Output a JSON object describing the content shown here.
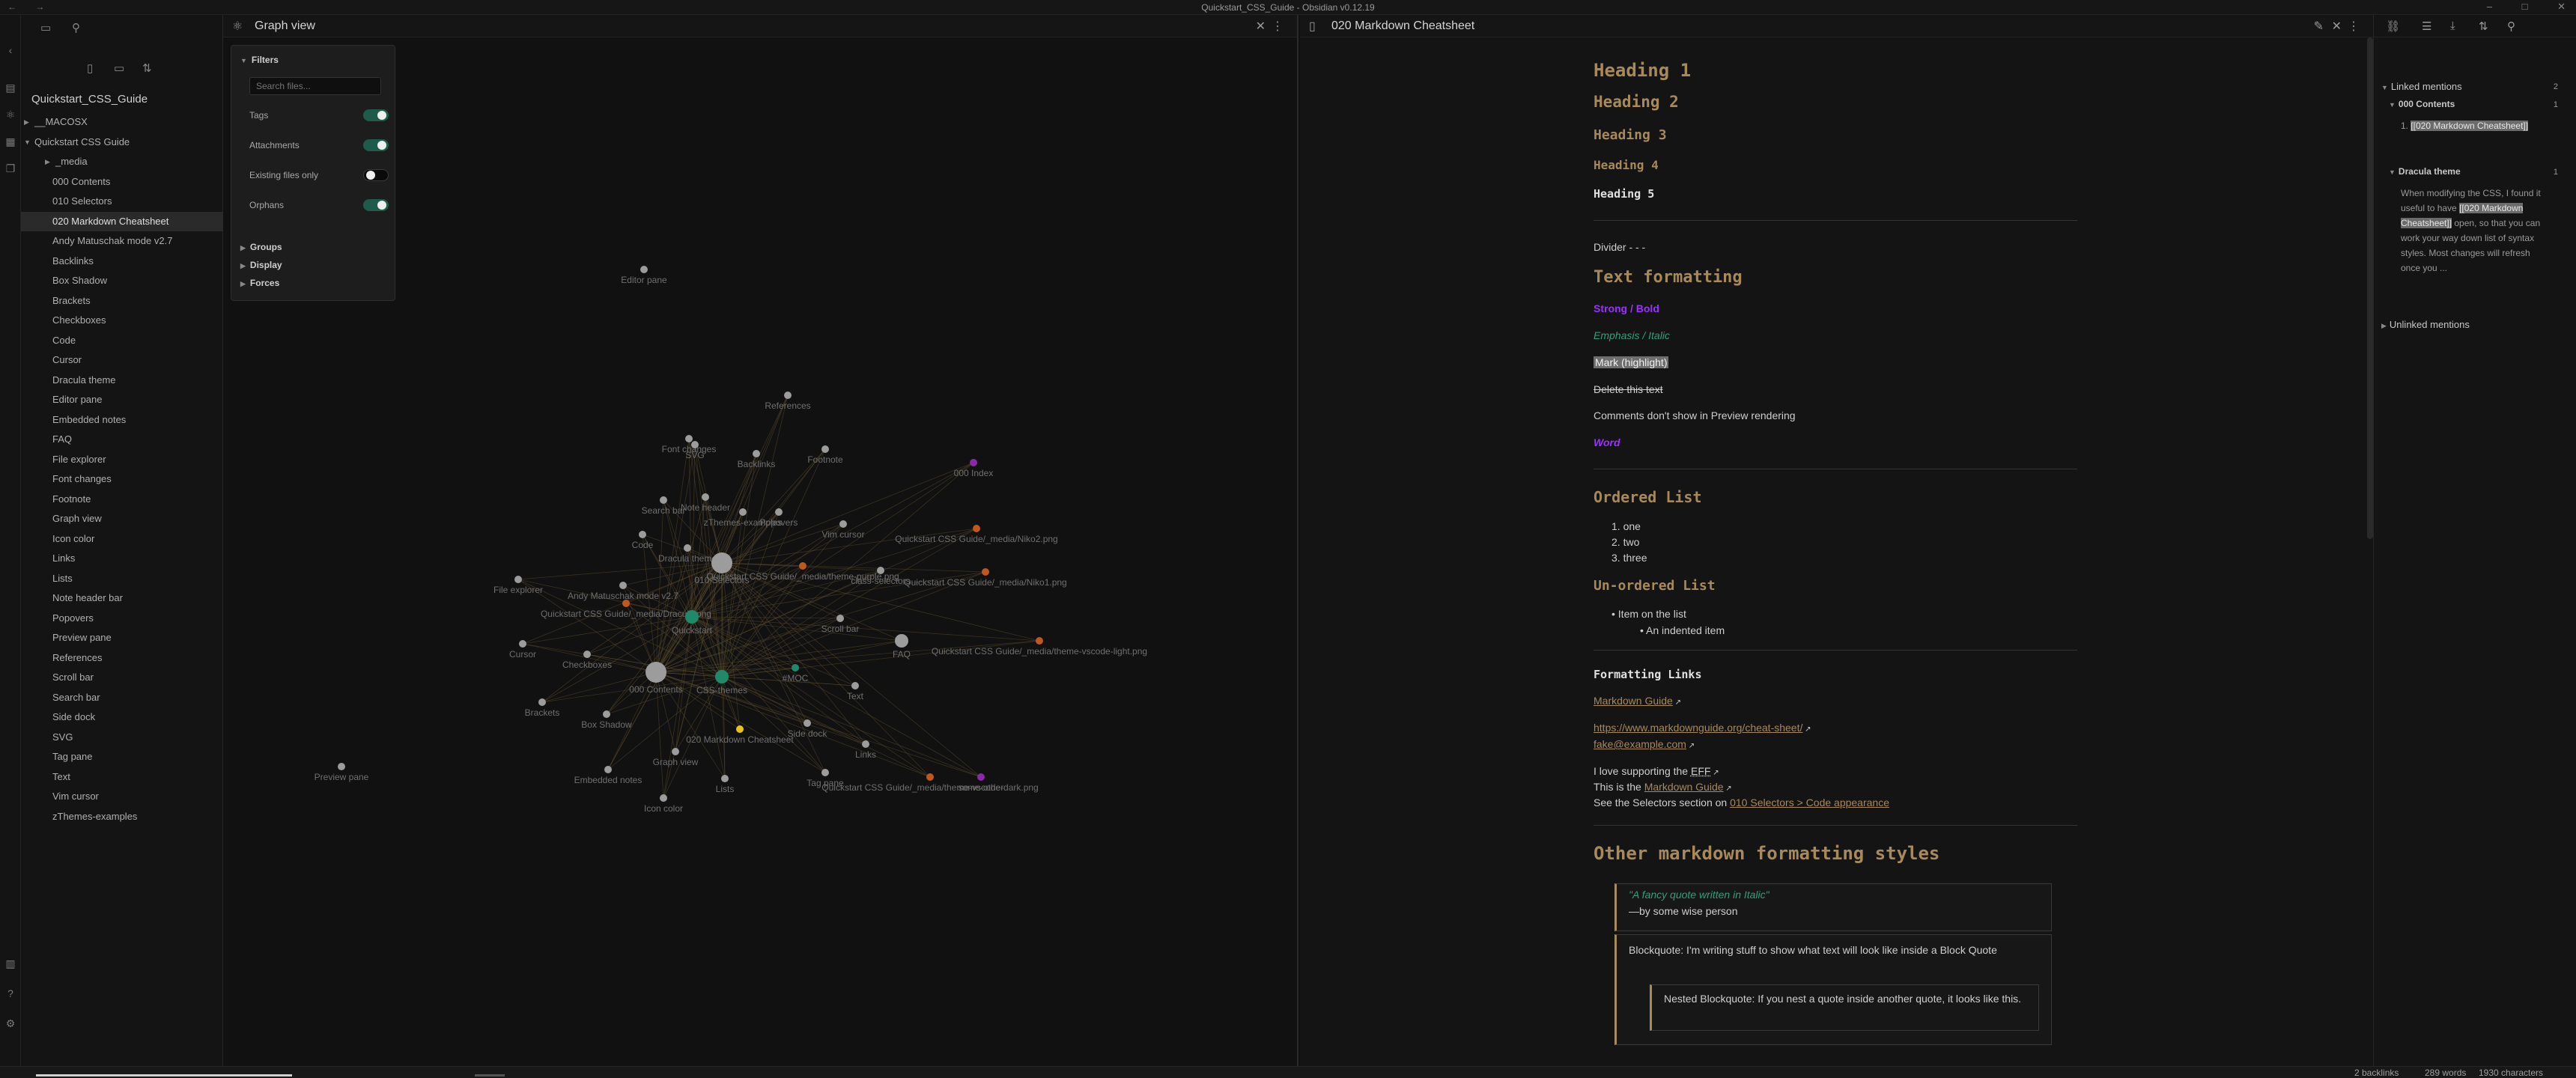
{
  "window": {
    "title": "Quickstart_CSS_Guide - Obsidian v0.12.19",
    "nav_back": "←",
    "nav_forward": "→",
    "minimize": "–",
    "maximize": "□",
    "close": "✕"
  },
  "ribbon": {
    "icons": [
      "collapse-icon",
      "quick-switcher-icon",
      "graph-icon",
      "calendar-icon",
      "copy-icon",
      "vault-icon",
      "help-icon",
      "settings-icon"
    ]
  },
  "left_sidebar": {
    "vault_name": "Quickstart_CSS_Guide",
    "tree": [
      {
        "label": "__MACOSX",
        "level": 0,
        "folder": true,
        "expanded": false
      },
      {
        "label": "Quickstart CSS Guide",
        "level": 0,
        "folder": true,
        "expanded": true
      },
      {
        "label": "_media",
        "level": 1,
        "folder": true,
        "expanded": false
      },
      {
        "label": "000 Contents",
        "level": 1
      },
      {
        "label": "010 Selectors",
        "level": 1
      },
      {
        "label": "020 Markdown Cheatsheet",
        "level": 1,
        "active": true
      },
      {
        "label": "Andy Matuschak mode v2.7",
        "level": 1
      },
      {
        "label": "Backlinks",
        "level": 1
      },
      {
        "label": "Box Shadow",
        "level": 1
      },
      {
        "label": "Brackets",
        "level": 1
      },
      {
        "label": "Checkboxes",
        "level": 1
      },
      {
        "label": "Code",
        "level": 1
      },
      {
        "label": "Cursor",
        "level": 1
      },
      {
        "label": "Dracula theme",
        "level": 1
      },
      {
        "label": "Editor pane",
        "level": 1
      },
      {
        "label": "Embedded notes",
        "level": 1
      },
      {
        "label": "FAQ",
        "level": 1
      },
      {
        "label": "File explorer",
        "level": 1
      },
      {
        "label": "Font changes",
        "level": 1
      },
      {
        "label": "Footnote",
        "level": 1
      },
      {
        "label": "Graph view",
        "level": 1
      },
      {
        "label": "Icon color",
        "level": 1
      },
      {
        "label": "Links",
        "level": 1
      },
      {
        "label": "Lists",
        "level": 1
      },
      {
        "label": "Note header bar",
        "level": 1
      },
      {
        "label": "Popovers",
        "level": 1
      },
      {
        "label": "Preview pane",
        "level": 1
      },
      {
        "label": "References",
        "level": 1
      },
      {
        "label": "Scroll bar",
        "level": 1
      },
      {
        "label": "Search bar",
        "level": 1
      },
      {
        "label": "Side dock",
        "level": 1
      },
      {
        "label": "SVG",
        "level": 1
      },
      {
        "label": "Tag pane",
        "level": 1
      },
      {
        "label": "Text",
        "level": 1
      },
      {
        "label": "Vim cursor",
        "level": 1
      },
      {
        "label": "zThemes-examples",
        "level": 1
      }
    ]
  },
  "graph": {
    "title": "Graph view",
    "filters": {
      "header": "Filters",
      "search_placeholder": "Search files...",
      "toggles": [
        {
          "label": "Tags",
          "on": true
        },
        {
          "label": "Attachments",
          "on": true
        },
        {
          "label": "Existing files only",
          "on": false
        },
        {
          "label": "Orphans",
          "on": true
        }
      ],
      "sections": [
        "Groups",
        "Display",
        "Forces"
      ]
    },
    "nodes": [
      {
        "label": "Editor pane",
        "color": "grey",
        "size": "s"
      },
      {
        "label": "References",
        "color": "grey",
        "size": "s"
      },
      {
        "label": "Font changes",
        "color": "grey",
        "size": "s"
      },
      {
        "label": "SVG",
        "color": "grey",
        "size": "s"
      },
      {
        "label": "Backlinks",
        "color": "grey",
        "size": "s"
      },
      {
        "label": "Footnote",
        "color": "grey",
        "size": "s"
      },
      {
        "label": "000 Index",
        "color": "purple",
        "size": "s"
      },
      {
        "label": "Search bar",
        "color": "grey",
        "size": "s"
      },
      {
        "label": "Note header",
        "color": "grey",
        "size": "s"
      },
      {
        "label": "zThemes-examples",
        "color": "grey",
        "size": "s"
      },
      {
        "label": "Popovers",
        "color": "grey",
        "size": "s"
      },
      {
        "label": "Vim cursor",
        "color": "grey",
        "size": "s"
      },
      {
        "label": "Quickstart CSS Guide/_media/Niko2.png",
        "color": "orange",
        "size": "s"
      },
      {
        "label": "Code",
        "color": "grey",
        "size": "s"
      },
      {
        "label": "Dracula theme",
        "color": "grey",
        "size": "s"
      },
      {
        "label": "010 Selectors",
        "color": "grey",
        "size": "l"
      },
      {
        "label": "Quickstart CSS Guide/_media/theme-purple.png",
        "color": "orange",
        "size": "s"
      },
      {
        "label": "class-selectors",
        "color": "grey",
        "size": "s"
      },
      {
        "label": "Quickstart CSS Guide/_media/Niko1.png",
        "color": "orange",
        "size": "s"
      },
      {
        "label": "File explorer",
        "color": "grey",
        "size": "s"
      },
      {
        "label": "Andy Matuschak mode v2.7",
        "color": "grey",
        "size": "s"
      },
      {
        "label": "Quickstart CSS Guide/_media/Dracula.png",
        "color": "orange",
        "size": "s"
      },
      {
        "label": "Quickstart",
        "color": "green",
        "size": "m"
      },
      {
        "label": "Scroll bar",
        "color": "grey",
        "size": "s"
      },
      {
        "label": "FAQ",
        "color": "grey",
        "size": "m"
      },
      {
        "label": "Quickstart CSS Guide/_media/theme-vscode-light.png",
        "color": "orange",
        "size": "s"
      },
      {
        "label": "Cursor",
        "color": "grey",
        "size": "s"
      },
      {
        "label": "Checkboxes",
        "color": "grey",
        "size": "s"
      },
      {
        "label": "000 Contents",
        "color": "grey",
        "size": "l"
      },
      {
        "label": "CSS-themes",
        "color": "green",
        "size": "m"
      },
      {
        "label": "#MOC",
        "color": "green",
        "size": "s"
      },
      {
        "label": "Text",
        "color": "grey",
        "size": "s"
      },
      {
        "label": "Brackets",
        "color": "grey",
        "size": "s"
      },
      {
        "label": "Box Shadow",
        "color": "grey",
        "size": "s"
      },
      {
        "label": "Side dock",
        "color": "grey",
        "size": "s"
      },
      {
        "label": "020 Markdown Cheatsheet",
        "color": "yellow",
        "size": "s"
      },
      {
        "label": "Graph view",
        "color": "grey",
        "size": "s"
      },
      {
        "label": "Links",
        "color": "grey",
        "size": "s"
      },
      {
        "label": "Preview pane",
        "color": "grey",
        "size": "s"
      },
      {
        "label": "Embedded notes",
        "color": "grey",
        "size": "s"
      },
      {
        "label": "Lists",
        "color": "grey",
        "size": "s"
      },
      {
        "label": "Tag pane",
        "color": "grey",
        "size": "s"
      },
      {
        "label": "Quickstart CSS Guide/_media/theme-vscode-dark.png",
        "color": "orange",
        "size": "s"
      },
      {
        "label": "Icon color",
        "color": "grey",
        "size": "s"
      },
      {
        "label": "some-other",
        "color": "purple",
        "size": "s"
      }
    ]
  },
  "editor": {
    "title": "020 Markdown Cheatsheet",
    "headings": [
      "Heading 1",
      "Heading 2",
      "Heading 3",
      "Heading 4",
      "Heading 5"
    ],
    "divider_text": "Divider - - -",
    "text_formatting_heading": "Text formatting",
    "strong": "Strong / Bold",
    "emphasis": "Emphasis / Italic",
    "mark": "Mark (highlight)",
    "strike": "Delete this text",
    "comments": "Comments don't show in Preview rendering",
    "word": "Word",
    "ordered_heading": "Ordered List",
    "ordered_items": [
      "one",
      "two",
      "three"
    ],
    "unordered_heading": "Un-ordered List",
    "unordered_item": "Item on the list",
    "unordered_nested": "An indented item",
    "links_heading": "Formatting Links",
    "link_markdown_guide": "Markdown Guide",
    "link_cheat_sheet": "https://www.markdownguide.org/cheat-sheet/",
    "link_email": "fake@example.com",
    "support_prefix": "I love supporting the ",
    "support_abbr": "EFF",
    "this_is_prefix": "This is the ",
    "this_is_link": "Markdown Guide",
    "see_prefix": "See the Selectors section on ",
    "see_link": "010 Selectors > Code appearance",
    "other_heading": "Other markdown formatting styles",
    "quote_text": "\"A fancy quote written in Italic\"",
    "quote_author": "—by some wise person",
    "blockquote": "Blockquote: I'm writing stuff to show what text will look like inside a Block Quote",
    "nested_blockquote": "Nested Blockquote: If you nest a quote inside another quote, it looks like this."
  },
  "right_sidebar": {
    "linked_mentions": "Linked mentions",
    "linked_count": "2",
    "groups": [
      {
        "name": "000 Contents",
        "count": "1",
        "snippet_pre": "1. ",
        "snippet_hl": "[[020 Markdown Cheatsheet]]",
        "snippet_post": ""
      },
      {
        "name": "Dracula theme",
        "count": "1",
        "snippet_pre": "When modifying the CSS, I found it useful to have ",
        "snippet_hl": "[[020 Markdown Cheatsheet]]",
        "snippet_post": " open, so that you can work your way down list of syntax styles. Most changes will refresh once you ..."
      }
    ],
    "unlinked_mentions": "Unlinked mentions"
  },
  "status": {
    "backlinks": "2 backlinks",
    "words": "289 words",
    "characters": "1930 characters"
  },
  "colors": {
    "accent": "#a8895a",
    "strong": "#9b30ff",
    "emphasis": "#2fa07a",
    "node_grey": "#9c9c9c",
    "node_green": "#1f8a6a",
    "node_orange": "#c0571f",
    "node_purple": "#8a2aa8",
    "node_yellow": "#e6c419"
  }
}
